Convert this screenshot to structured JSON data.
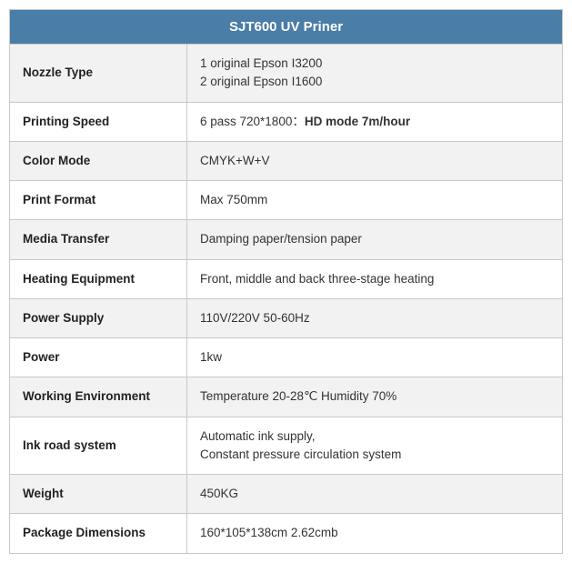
{
  "header": {
    "title": "SJT600 UV Priner"
  },
  "rows": [
    {
      "label": "Nozzle Type",
      "value": "1 original Epson I3200\n2 original Epson I1600",
      "html": true
    },
    {
      "label": "Printing Speed",
      "value": "6 pass 720*1800：HD mode 7m/hour",
      "html": true,
      "bold_part": "HD mode 7m/hour"
    },
    {
      "label": "Color Mode",
      "value": "CMYK+W+V"
    },
    {
      "label": "Print Format",
      "value": "Max 750mm"
    },
    {
      "label": "Media Transfer",
      "value": "Damping paper/tension paper"
    },
    {
      "label": "Heating Equipment",
      "value": "Front, middle and back three-stage heating"
    },
    {
      "label": "Power Supply",
      "value": "110V/220V 50-60Hz"
    },
    {
      "label": "Power",
      "value": "1kw"
    },
    {
      "label": "Working Environment",
      "value": "Temperature 20-28℃  Humidity 70%"
    },
    {
      "label": "Ink road system",
      "value": "Automatic ink supply,\nConstant pressure circulation system",
      "html": true
    },
    {
      "label": "Weight",
      "value": "450KG"
    },
    {
      "label": "Package Dimensions",
      "value": "160*105*138cm 2.62cmb"
    }
  ]
}
